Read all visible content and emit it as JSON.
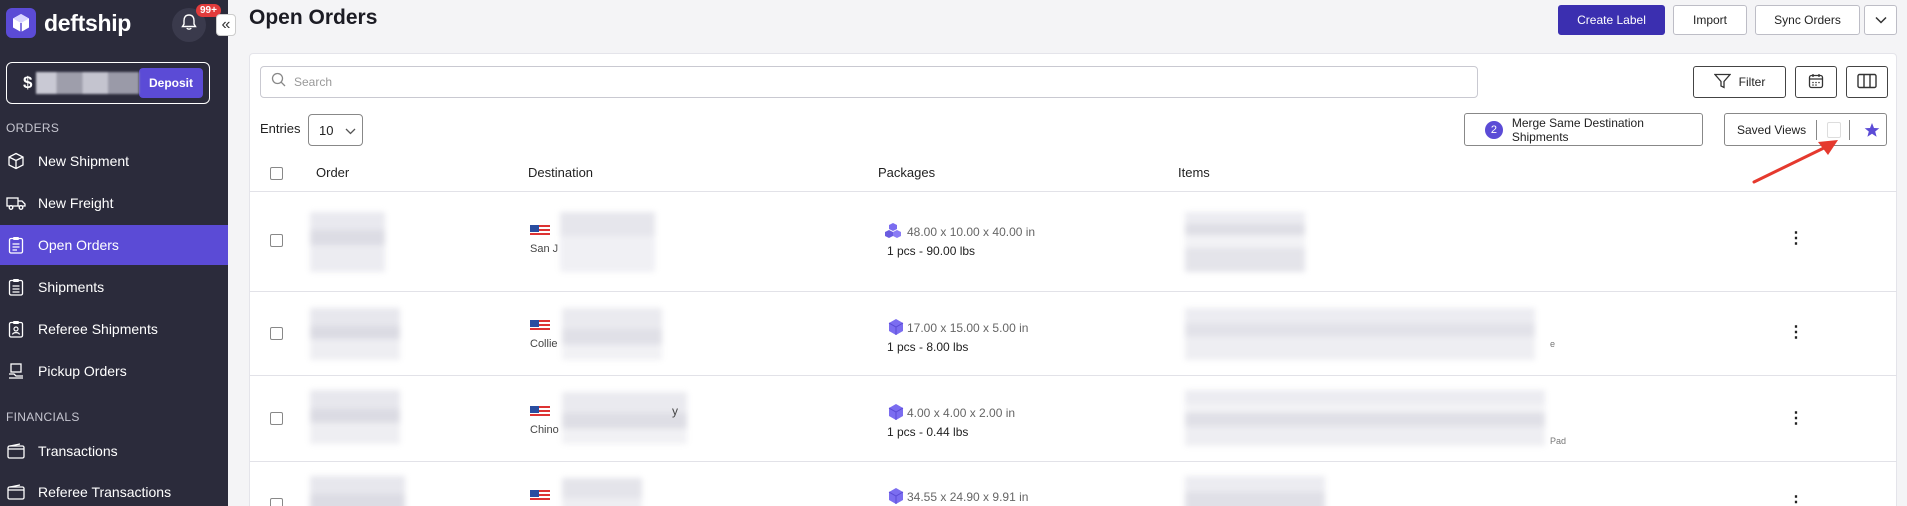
{
  "app": {
    "name": "deftship",
    "notifications": "99+",
    "collapse_glyph": "«"
  },
  "balance": {
    "currency": "$",
    "deposit_label": "Deposit"
  },
  "sidebar": {
    "sections": [
      {
        "label": "ORDERS"
      },
      {
        "label": "FINANCIALS"
      }
    ],
    "items": [
      {
        "label": "New Shipment",
        "icon": "box-icon"
      },
      {
        "label": "New Freight",
        "icon": "truck-icon"
      },
      {
        "label": "Open Orders",
        "icon": "clipboard-icon",
        "active": true
      },
      {
        "label": "Shipments",
        "icon": "clipboard-list-icon"
      },
      {
        "label": "Referee Shipments",
        "icon": "clipboard-user-icon"
      },
      {
        "label": "Pickup Orders",
        "icon": "pickup-icon"
      },
      {
        "label": "Transactions",
        "icon": "wallet-icon"
      },
      {
        "label": "Referee Transactions",
        "icon": "wallet-user-icon"
      }
    ]
  },
  "header": {
    "title": "Open Orders",
    "create_label": "Create Label",
    "import_label": "Import",
    "sync_label": "Sync Orders"
  },
  "toolbar": {
    "search_placeholder": "Search",
    "filter_label": "Filter",
    "entries_label": "Entries",
    "entries_value": "10",
    "merge_count": "2",
    "merge_label": "Merge Same Destination Shipments",
    "saved_views_label": "Saved Views"
  },
  "table": {
    "columns": [
      "Order",
      "Destination",
      "Packages",
      "Items"
    ],
    "rows": [
      {
        "city": "San J",
        "dims": "48.00 x 10.00 x 40.00 in",
        "weight": "1 pcs - 90.00 lbs",
        "item_suffix": ""
      },
      {
        "city": "Collie",
        "dims": "17.00 x 15.00 x 5.00 in",
        "weight": "1 pcs - 8.00 lbs",
        "item_suffix": "e"
      },
      {
        "city": "Chino",
        "dest_suffix": "y",
        "dims": "4.00 x 4.00 x 2.00 in",
        "weight": "1 pcs - 0.44 lbs",
        "item_suffix": "Pad"
      },
      {
        "city": "",
        "dims": "34.55 x 24.90 x 9.91 in",
        "weight": "",
        "item_suffix": ""
      }
    ]
  },
  "colors": {
    "sidebar": "#2b2b3b",
    "accent": "#5b4bd6",
    "primary_button": "#3b2fb0",
    "annotation_arrow": "#e5392e"
  }
}
